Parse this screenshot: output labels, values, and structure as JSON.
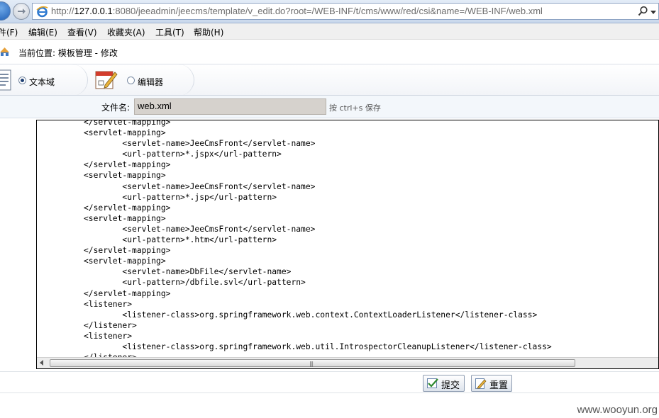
{
  "browser": {
    "url_prefix": "http://",
    "url_host": "127.0.0.1",
    "url_rest": ":8080/jeeadmin/jeecms/template/v_edit.do?root=/WEB-INF/t/cms/www/red/csi&name=/WEB-INF/web.xml"
  },
  "menu": {
    "items": [
      "件(F)",
      "编辑(E)",
      "查看(V)",
      "收藏夹(A)",
      "工具(T)",
      "帮助(H)"
    ]
  },
  "breadcrumb": {
    "text": "当前位置: 模板管理 - 修改"
  },
  "modes": {
    "textarea_label": "文本域",
    "editor_label": "编辑器",
    "selected": "文本域"
  },
  "file": {
    "label": "文件名:",
    "value": "web.xml",
    "hint": "按 ctrl+s 保存"
  },
  "code": {
    "lines": [
      "</servlet-mapping>",
      "<servlet-mapping>",
      "        <servlet-name>JeeCmsFront</servlet-name>",
      "        <url-pattern>*.jspx</url-pattern>",
      "</servlet-mapping>",
      "<servlet-mapping>",
      "        <servlet-name>JeeCmsFront</servlet-name>",
      "        <url-pattern>*.jsp</url-pattern>",
      "</servlet-mapping>",
      "<servlet-mapping>",
      "        <servlet-name>JeeCmsFront</servlet-name>",
      "        <url-pattern>*.htm</url-pattern>",
      "</servlet-mapping>",
      "<servlet-mapping>",
      "        <servlet-name>DbFile</servlet-name>",
      "        <url-pattern>/dbfile.svl</url-pattern>",
      "</servlet-mapping>",
      "<listener>",
      "        <listener-class>org.springframework.web.context.ContextLoaderListener</listener-class>",
      "</listener>",
      "<listener>",
      "        <listener-class>org.springframework.web.util.IntrospectorCleanupListener</listener-class>",
      "</listener>"
    ]
  },
  "actions": {
    "submit_label": "提交",
    "reset_label": "重置"
  },
  "watermark": "www.wooyun.org",
  "colors": {
    "accent": "#1f5fb6",
    "field_bg": "#d6d2cd"
  }
}
